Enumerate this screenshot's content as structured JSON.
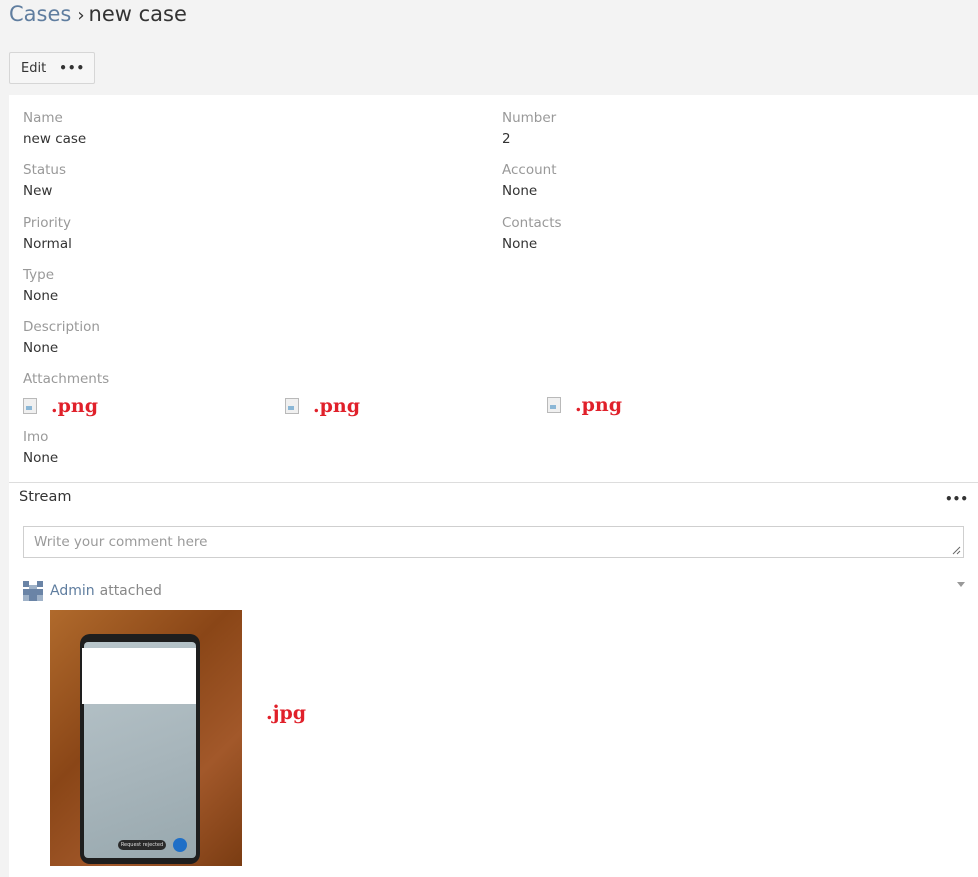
{
  "breadcrumb": {
    "parent": "Cases",
    "separator": "›",
    "current": "new case"
  },
  "toolbar": {
    "edit_label": "Edit",
    "more_label": "•••"
  },
  "fields": {
    "name": {
      "label": "Name",
      "value": "new case"
    },
    "number": {
      "label": "Number",
      "value": "2"
    },
    "status": {
      "label": "Status",
      "value": "New"
    },
    "account": {
      "label": "Account",
      "value": "None"
    },
    "priority": {
      "label": "Priority",
      "value": "Normal"
    },
    "contacts": {
      "label": "Contacts",
      "value": "None"
    },
    "type": {
      "label": "Type",
      "value": "None"
    },
    "description": {
      "label": "Description",
      "value": "None"
    },
    "attachments": {
      "label": "Attachments",
      "items": [
        ".png",
        ".png",
        ".png"
      ]
    },
    "imo": {
      "label": "Imo",
      "value": "None"
    }
  },
  "stream": {
    "title": "Stream",
    "more_label": "•••",
    "comment_placeholder": "Write your comment here",
    "note": {
      "user": "Admin",
      "action": "attached",
      "attachment_ext": ".jpg",
      "toast_text": "Request rejected"
    }
  },
  "colors": {
    "link": "#5f7d9f",
    "attachment_text": "#e0202a",
    "fab": "#1f6fc7"
  }
}
